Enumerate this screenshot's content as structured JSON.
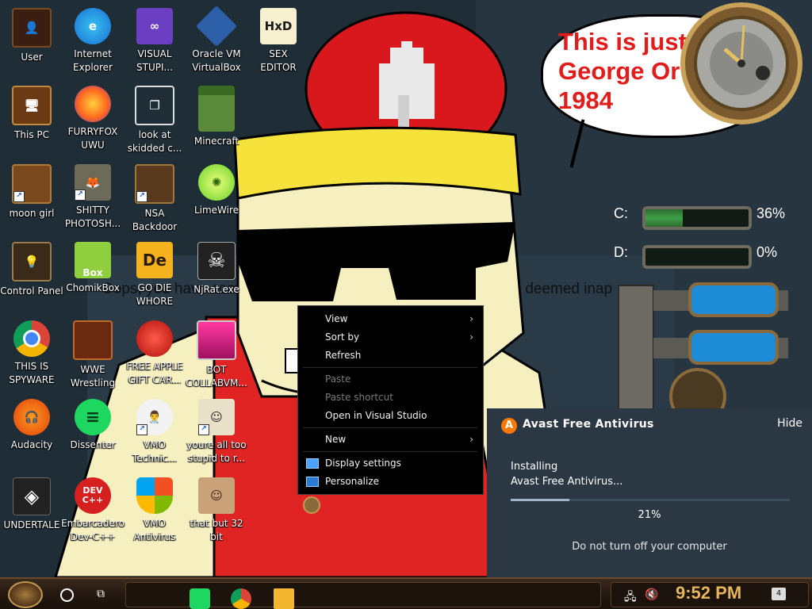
{
  "wallpaper": {
    "bubble_text": "This is just\nGeorge Or\n1984",
    "web_text_left": "Oops, you have come to",
    "web_text_right": "s been deemed inap"
  },
  "gauges": [
    {
      "drive": "C:",
      "percent": "36%",
      "fill_fraction": 0.36
    },
    {
      "drive": "D:",
      "percent": "0%",
      "fill_fraction": 0.0
    }
  ],
  "desktop_icons": [
    {
      "label": "User",
      "icon": "user-folder-icon"
    },
    {
      "label": "Internet\nExplorer",
      "icon": "edge-icon"
    },
    {
      "label": "VISUAL\nSTUPI...",
      "icon": "visual-studio-icon"
    },
    {
      "label": "Oracle VM\nVirtualBox",
      "icon": "virtualbox-icon"
    },
    {
      "label": "SEX\nEDITOR",
      "icon": "hxd-icon"
    },
    {
      "label": "This PC",
      "icon": "this-pc-icon"
    },
    {
      "label": "FURRYFOX\nUWU",
      "icon": "firefox-icon"
    },
    {
      "label": "look at\nskidded c...",
      "icon": "copy-icon"
    },
    {
      "label": "Minecraft",
      "icon": "minecraft-icon"
    },
    {
      "label": "moon girl",
      "icon": "folder-icon"
    },
    {
      "label": "SHITTY\nPHOTOSH...",
      "icon": "gimp-icon"
    },
    {
      "label": "NSA\nBackdoor",
      "icon": "steampunk-box-icon"
    },
    {
      "label": "LimeWire",
      "icon": "limewire-icon"
    },
    {
      "label": "Control Panel",
      "icon": "control-panel-icon"
    },
    {
      "label": "ChomikBox",
      "icon": "chomikbox-icon"
    },
    {
      "label": "GO DIE\nWHORE",
      "icon": "de-app-icon"
    },
    {
      "label": "NjRat.exe",
      "icon": "skull-icon"
    },
    {
      "label": "THIS IS\nSPYWARE",
      "icon": "chrome-icon"
    },
    {
      "label": "WWE\nWrestling",
      "icon": "oven-icon"
    },
    {
      "label": "FREE APPLE\nGIFT CAR...",
      "icon": "apple-icon"
    },
    {
      "label": "BOT\nCOLLABVM...",
      "icon": "monitor-icon"
    },
    {
      "label": "Audacity",
      "icon": "audacity-icon"
    },
    {
      "label": "Dissenter",
      "icon": "spotify-icon"
    },
    {
      "label": "VMO\nTechnic...",
      "icon": "doctor-icon"
    },
    {
      "label": "youre all too\nstupid to r...",
      "icon": "portrait-icon"
    },
    {
      "label": "UNDERTALE",
      "icon": "unity-icon"
    },
    {
      "label": "Embarcadero\nDev-C++",
      "icon": "devcpp-icon"
    },
    {
      "label": "VMO\nAntivirus",
      "icon": "shield-icon"
    },
    {
      "label": "that but 32\nbit",
      "icon": "portrait2-icon"
    }
  ],
  "context_menu": {
    "items": [
      {
        "label": "View",
        "submenu": true,
        "disabled": false
      },
      {
        "label": "Sort by",
        "submenu": true,
        "disabled": false
      },
      {
        "label": "Refresh",
        "submenu": false,
        "disabled": false
      },
      {
        "label": "Paste",
        "submenu": false,
        "disabled": true
      },
      {
        "label": "Paste shortcut",
        "submenu": false,
        "disabled": true
      },
      {
        "label": "Open in Visual Studio",
        "submenu": false,
        "disabled": false
      },
      {
        "label": "New",
        "submenu": true,
        "disabled": false
      },
      {
        "label": "Display settings",
        "submenu": false,
        "disabled": false
      },
      {
        "label": "Personalize",
        "submenu": false,
        "disabled": false
      }
    ]
  },
  "toast": {
    "title": "Avast Free Antivirus",
    "hide_label": "Hide",
    "line1": "Installing",
    "line2": "Avast Free Antivirus...",
    "progress_fraction": 0.21,
    "progress_text": "21%",
    "warning": "Do not turn off your computer",
    "accent": "#ff7800"
  },
  "taskbar": {
    "pinned": [
      "spotify-icon",
      "chrome-icon",
      "file-explorer-icon"
    ],
    "clock": "9:52 PM",
    "notification_count": "4"
  }
}
